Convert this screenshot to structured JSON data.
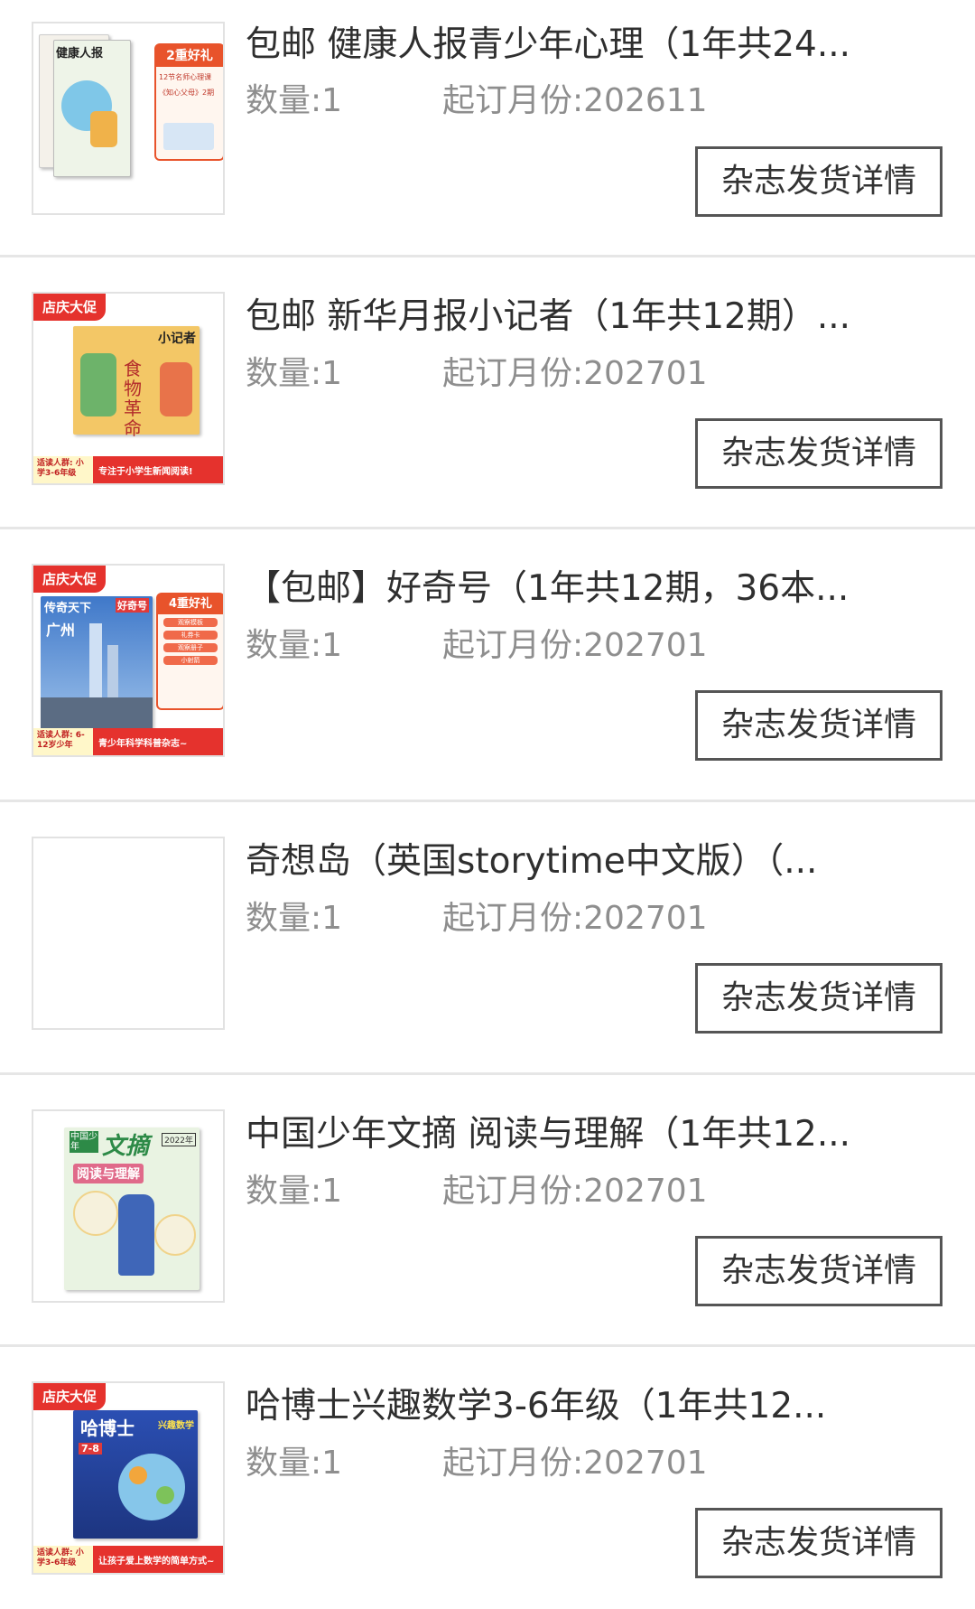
{
  "orders": [
    {
      "title": "包邮 健康人报青少年心理（1年共24...",
      "qty_label": "数量:1",
      "month_label": "起订月份:202611",
      "button": "杂志发货详情",
      "thumb": {
        "promo_tag": "",
        "headline": "健康人报",
        "gift": "2重好礼",
        "gift_lines": [
          "12节名师心理课",
          "《知心父母》2期"
        ],
        "band_left": "",
        "band_right": ""
      }
    },
    {
      "title": "包邮 新华月报小记者（1年共12期）...",
      "qty_label": "数量:1",
      "month_label": "起订月份:202701",
      "button": "杂志发货详情",
      "thumb": {
        "promo_tag": "店庆大促",
        "headline": "小记者",
        "art_text": "食物革命",
        "band_left": "适读人群: 小学3-6年级",
        "band_right": "专注于小学生新闻阅读!"
      }
    },
    {
      "title": "【包邮】好奇号（1年共12期，36本...",
      "qty_label": "数量:1",
      "month_label": "起订月份:202701",
      "button": "杂志发货详情",
      "thumb": {
        "promo_tag": "店庆大促",
        "headline": "传奇天下",
        "subhead": "好奇号",
        "city": "广州",
        "gift": "4重好礼",
        "gift_lines": [
          "观察模板",
          "礼券卡",
          "观察册子",
          "小射箭"
        ],
        "band_left": "适读人群: 6-12岁少年",
        "band_right": "青少年科学科普杂志~"
      }
    },
    {
      "title": "奇想岛（英国storytime中文版）（...",
      "qty_label": "数量:1",
      "month_label": "起订月份:202701",
      "button": "杂志发货详情",
      "thumb": null
    },
    {
      "title": "中国少年文摘 阅读与理解（1年共12...",
      "qty_label": "数量:1",
      "month_label": "起订月份:202701",
      "button": "杂志发货详情",
      "thumb": {
        "promo_tag": "",
        "headline": "文摘",
        "mini": "中国少年",
        "subhead": "阅读与理解",
        "issue": "2022年",
        "band_left": "",
        "band_right": ""
      }
    },
    {
      "title": "哈博士兴趣数学3-6年级（1年共12...",
      "qty_label": "数量:1",
      "month_label": "起订月份:202701",
      "button": "杂志发货详情",
      "thumb": {
        "promo_tag": "店庆大促",
        "headline": "哈博士",
        "subhead": "兴趣数学",
        "grade": "7-8",
        "band_left": "适读人群: 小学3-6年级",
        "band_right": "让孩子爱上数学的简单方式~"
      }
    }
  ]
}
